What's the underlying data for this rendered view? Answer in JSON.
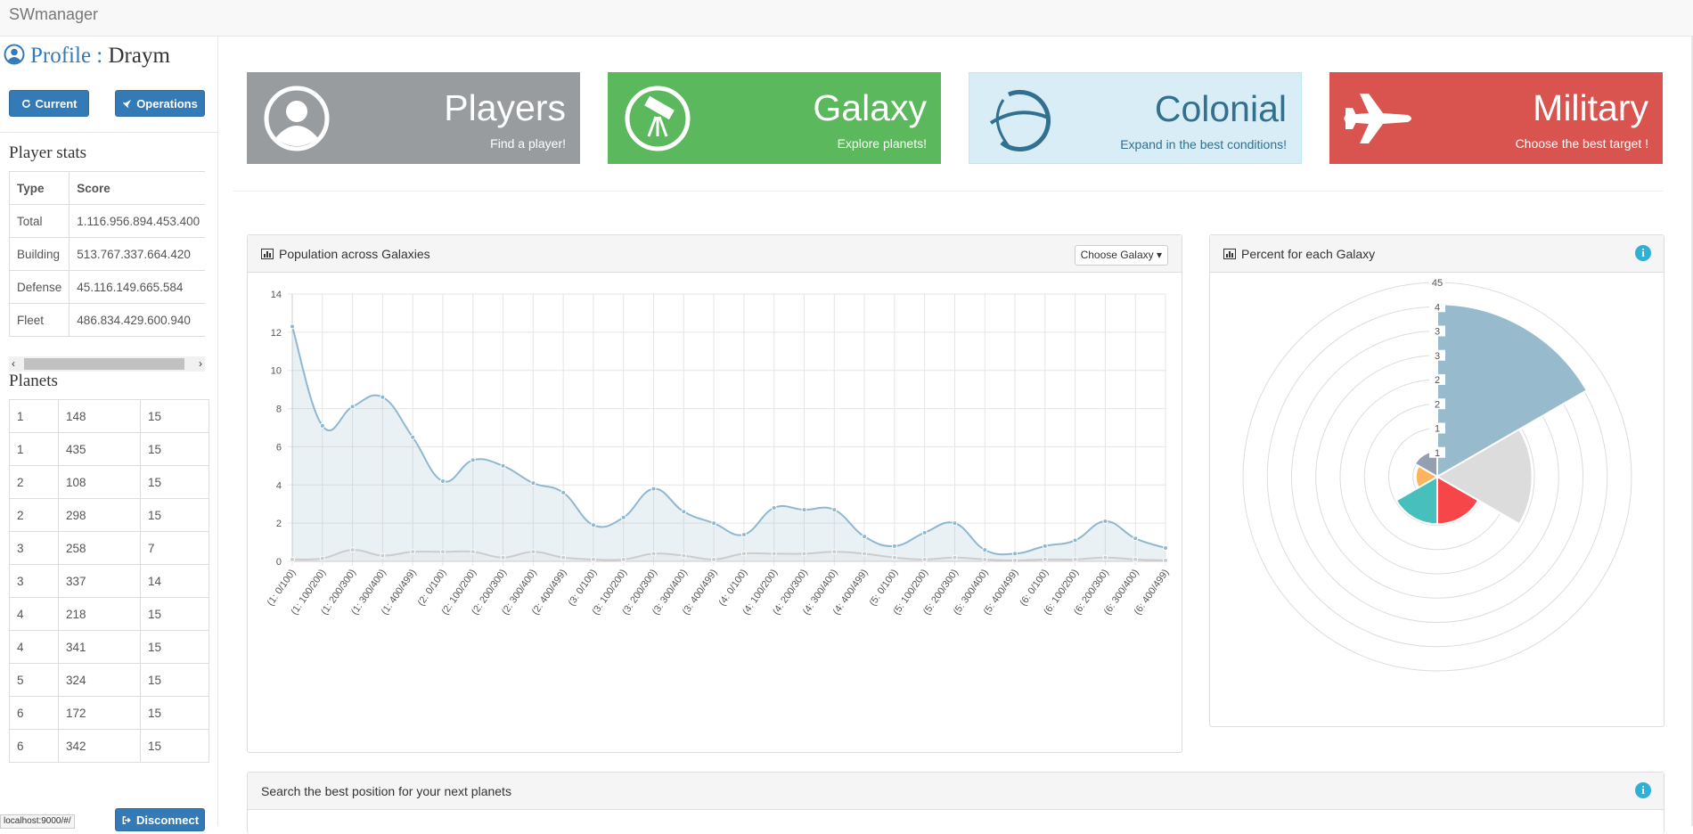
{
  "app": {
    "title": "SWmanager"
  },
  "profile": {
    "label": "Profile :",
    "name": "Draym"
  },
  "buttons": {
    "current": "Current",
    "operations": "Operations",
    "disconnect": "Disconnect"
  },
  "player_stats": {
    "title": "Player stats",
    "headers": [
      "Type",
      "Score"
    ],
    "rows": [
      [
        "Total",
        "1.116.956.894.453.400"
      ],
      [
        "Building",
        "513.767.337.664.420"
      ],
      [
        "Defense",
        "45.116.149.665.584"
      ],
      [
        "Fleet",
        "486.834.429.600.940"
      ]
    ]
  },
  "planets": {
    "title": "Planets",
    "rows": [
      [
        "1",
        "148",
        "15"
      ],
      [
        "1",
        "435",
        "15"
      ],
      [
        "2",
        "108",
        "15"
      ],
      [
        "2",
        "298",
        "15"
      ],
      [
        "3",
        "258",
        "7"
      ],
      [
        "3",
        "337",
        "14"
      ],
      [
        "4",
        "218",
        "15"
      ],
      [
        "4",
        "341",
        "15"
      ],
      [
        "5",
        "324",
        "15"
      ],
      [
        "6",
        "172",
        "15"
      ],
      [
        "6",
        "342",
        "15"
      ]
    ]
  },
  "tiles": [
    {
      "title": "Players",
      "subtitle": "Find a player!",
      "icon": "user-icon",
      "bg": "#999c9f",
      "fg": "#ffffff"
    },
    {
      "title": "Galaxy",
      "subtitle": "Explore planets!",
      "icon": "telescope-icon",
      "bg": "#5cb85c",
      "fg": "#ffffff"
    },
    {
      "title": "Colonial",
      "subtitle": "Expand in the best conditions!",
      "icon": "planet-icon",
      "bg": "#d9edf7",
      "fg": "#31708f"
    },
    {
      "title": "Military",
      "subtitle": "Choose the best target !",
      "icon": "jet-icon",
      "bg": "#d9534f",
      "fg": "#ffffff"
    }
  ],
  "population_panel": {
    "title": "Population across Galaxies",
    "dropdown": "Choose Galaxy"
  },
  "percent_panel": {
    "title": "Percent for each Galaxy"
  },
  "search_panel": {
    "title": "Search the best position for your next planets"
  },
  "status_bar": "localhost:9000/#/",
  "colors": {
    "primary": "#337ab7",
    "info": "#31b0d5",
    "line": "#8fb8d0",
    "line2": "#cccccc"
  },
  "chart_data": [
    {
      "type": "line",
      "title": "",
      "xlabel": "",
      "ylabel": "",
      "ylim": [
        0,
        14
      ],
      "yticks": [
        0,
        2,
        4,
        6,
        8,
        10,
        12,
        14
      ],
      "categories": [
        "(1: 0/100)",
        "(1: 100/200)",
        "(1: 200/300)",
        "(1: 300/400)",
        "(1: 400/499)",
        "(2: 0/100)",
        "(2: 100/200)",
        "(2: 200/300)",
        "(2: 300/400)",
        "(2: 400/499)",
        "(3: 0/100)",
        "(3: 100/200)",
        "(3: 200/300)",
        "(3: 300/400)",
        "(3: 400/499)",
        "(4: 0/100)",
        "(4: 100/200)",
        "(4: 200/300)",
        "(4: 300/400)",
        "(4: 400/499)",
        "(5: 0/100)",
        "(5: 100/200)",
        "(5: 200/300)",
        "(5: 300/400)",
        "(5: 400/499)",
        "(6: 0/100)",
        "(6: 100/200)",
        "(6: 200/300)",
        "(6: 300/400)",
        "(6: 400/499)"
      ],
      "series": [
        {
          "values": [
            12.3,
            7.1,
            8.1,
            8.6,
            6.5,
            4.2,
            5.3,
            5.0,
            4.1,
            3.6,
            1.9,
            2.3,
            3.8,
            2.6,
            2.0,
            1.4,
            2.8,
            2.7,
            2.7,
            1.3,
            0.8,
            1.5,
            2.0,
            0.6,
            0.4,
            0.8,
            1.1,
            2.1,
            1.2,
            0.7
          ]
        },
        {
          "values": [
            0.1,
            0.15,
            0.6,
            0.3,
            0.5,
            0.5,
            0.5,
            0.2,
            0.5,
            0.2,
            0.1,
            0.1,
            0.4,
            0.3,
            0.1,
            0.4,
            0.4,
            0.4,
            0.5,
            0.4,
            0.2,
            0.1,
            0.2,
            0.1,
            0.05,
            0.1,
            0.1,
            0.2,
            0.1,
            0.05
          ]
        }
      ]
    },
    {
      "type": "pie",
      "subtype": "polar-area",
      "title": "",
      "r_max": 45,
      "scale_labels": [
        "45",
        "4",
        "3",
        "3",
        "2",
        "2",
        "1",
        "1"
      ],
      "values": [
        40,
        22,
        11,
        11,
        5,
        6
      ],
      "colors": [
        "#97bbcd",
        "#dcdcdc",
        "#f7464a",
        "#46bfbd",
        "#fdb45c",
        "#949fb1"
      ]
    }
  ]
}
